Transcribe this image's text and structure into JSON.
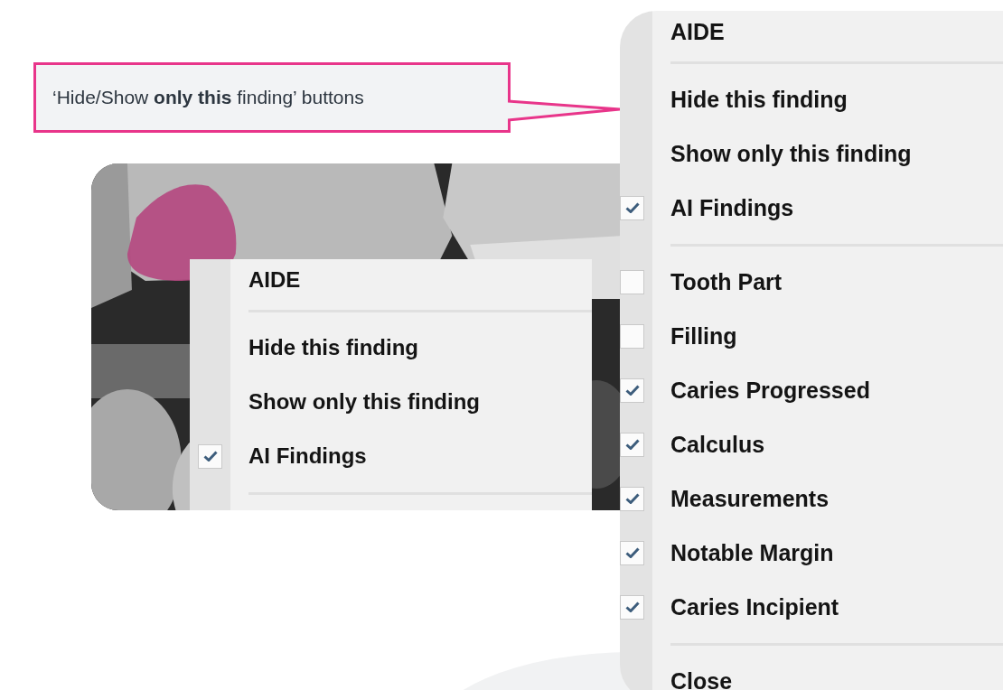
{
  "callout": {
    "text": "‘Hide/Show **only this** finding’ buttons"
  },
  "preview": {
    "kind": "picture",
    "menu": {
      "more_below": true,
      "sections": [
        [
          {
            "label": "AIDE",
            "kind": "title"
          }
        ],
        [
          {
            "label": "Hide this finding",
            "kind": "command"
          },
          {
            "label": "Show only this finding",
            "kind": "command"
          },
          {
            "label": "AI Findings",
            "kind": "toggle",
            "checked": true
          }
        ]
      ]
    }
  },
  "menu": {
    "sections": [
      [
        {
          "label": "AIDE",
          "kind": "title"
        }
      ],
      [
        {
          "label": "Hide this finding",
          "kind": "command"
        },
        {
          "label": "Show only this finding",
          "kind": "command"
        },
        {
          "label": "AI Findings",
          "kind": "toggle",
          "checked": true
        }
      ],
      [
        {
          "label": "Tooth Part",
          "kind": "toggle",
          "checked": false
        },
        {
          "label": "Filling",
          "kind": "toggle",
          "checked": false
        },
        {
          "label": "Caries Progressed",
          "kind": "toggle",
          "checked": true
        },
        {
          "label": "Calculus",
          "kind": "toggle",
          "checked": true
        },
        {
          "label": "Measurements",
          "kind": "toggle",
          "checked": true
        },
        {
          "label": "Notable Margin",
          "kind": "toggle",
          "checked": true
        },
        {
          "label": "Caries Incipient",
          "kind": "toggle",
          "checked": true
        }
      ],
      [
        {
          "label": "Close",
          "kind": "command"
        }
      ]
    ]
  }
}
